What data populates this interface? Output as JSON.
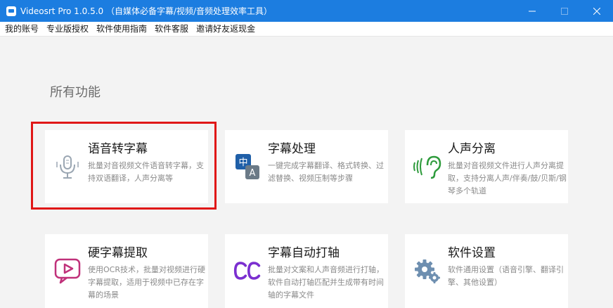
{
  "window": {
    "title": "Videosrt Pro 1.0.5.0 （自媒体必备字幕/视频/音频处理效率工具）",
    "controls": [
      "minimize",
      "maximize",
      "close"
    ]
  },
  "menu": {
    "items": [
      "我的账号",
      "专业版授权",
      "软件使用指南",
      "软件客服",
      "邀请好友返现金"
    ]
  },
  "main": {
    "section_title": "所有功能",
    "cards": [
      {
        "title": "语音转字幕",
        "desc": "批量对音视频文件语音转字幕，支持双语翻译，人声分离等",
        "icon": "microphone-icon",
        "color": "#9aa6b2"
      },
      {
        "title": "字幕处理",
        "desc": "一键完成字幕翻译、格式转换、过滤替换、视频压制等步骤",
        "icon": "translate-icon",
        "color": "#2a6fb8"
      },
      {
        "title": "人声分离",
        "desc": "批量对音视频文件进行人声分离提取，支持分离人声/伴奏/鼓/贝斯/钢琴多个轨道",
        "icon": "ear-icon",
        "color": "#2e9b3c"
      },
      {
        "title": "硬字幕提取",
        "desc": "使用OCR技术，批量对视频进行硬字幕提取，适用于视频中已存在字幕的场景",
        "icon": "video-ocr-icon",
        "color": "#c0317a"
      },
      {
        "title": "字幕自动打轴",
        "desc": "批量对文案和人声音频进行打轴，软件自动打轴匹配并生成带有时间轴的字幕文件",
        "icon": "cc-icon",
        "color": "#7b2fd0"
      },
      {
        "title": "软件设置",
        "desc": "软件通用设置（语音引擎、翻译引擎、其他设置）",
        "icon": "gear-icon",
        "color": "#6e8fb0"
      }
    ]
  },
  "colors": {
    "titlebar": "#1c7de0",
    "highlight": "#e01717"
  }
}
